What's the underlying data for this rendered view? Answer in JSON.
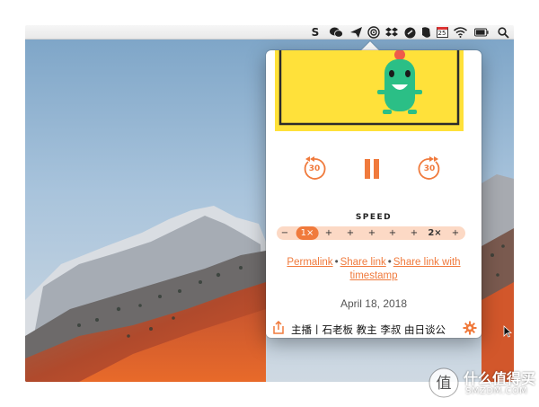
{
  "menubar": {
    "icons": [
      "skype-icon",
      "wechat-icon",
      "send-icon",
      "podcast-icon",
      "dropbox-icon",
      "cloud-icon",
      "evernote-icon",
      "calendar-icon",
      "wifi-icon",
      "battery-icon",
      "spotlight-search-icon"
    ],
    "skype_letter": "S",
    "calendar_day": "25",
    "battery_level": "",
    "accent_color": "#f07a3c"
  },
  "player": {
    "skip_back_seconds": "30",
    "skip_forward_seconds": "30",
    "state": "playing",
    "pause_icon": "pause-icon",
    "speed": {
      "label": "SPEED",
      "minus": "−",
      "current": "1×",
      "marks": [
        "+",
        "+",
        "+",
        "+",
        "+",
        "2×",
        "+"
      ],
      "value": 1.0
    },
    "links": {
      "permalink": "Permalink",
      "share_link": "Share link",
      "share_link_timestamp": "Share link with timestamp",
      "separator": "•"
    },
    "date": "April 18, 2018",
    "episode_title": "主播丨石老板 教主 李叔 由日谈公"
  },
  "watermark": {
    "cn": "什么值得买",
    "en": "SMZDM.COM"
  }
}
